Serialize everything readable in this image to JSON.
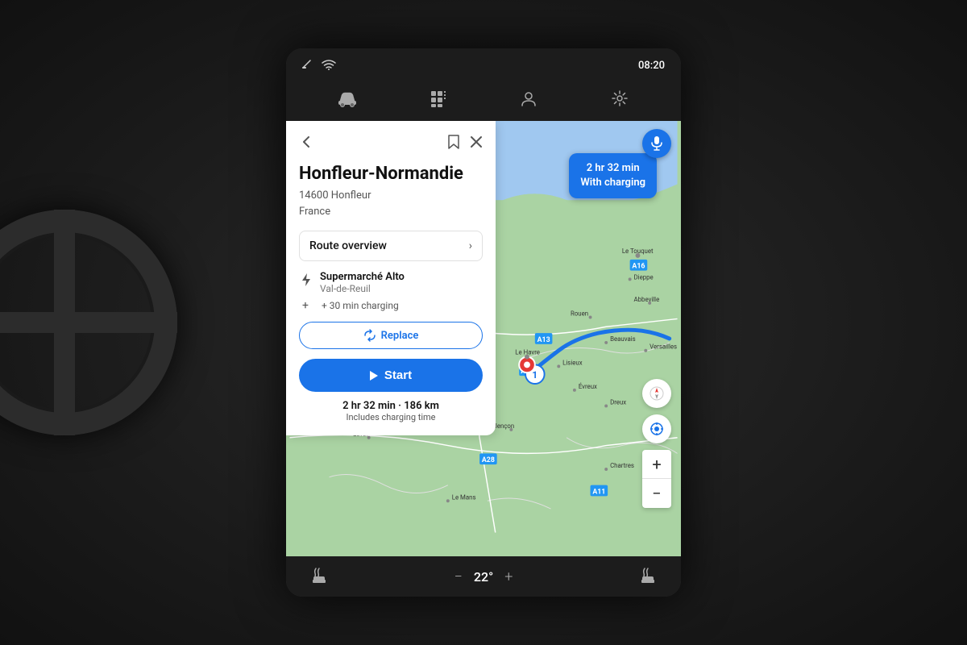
{
  "device": {
    "time": "08:20",
    "temperature": "22°"
  },
  "topbar": {
    "time": "08:20"
  },
  "navbar": {
    "car_icon": "🚗",
    "grid_icon": "⊞",
    "profile_icon": "👤",
    "settings_icon": "⚙"
  },
  "destination": {
    "name": "Honfleur-Normandie",
    "address_line1": "14600 Honfleur",
    "address_line2": "France"
  },
  "route": {
    "overview_label": "Route overview",
    "waypoint_name": "Supermarché Alto",
    "waypoint_sub": "Val-de-Reuil",
    "charging_text": "+ 30 min charging",
    "replace_label": "Replace",
    "start_label": "Start",
    "duration": "2 hr 32 min",
    "distance": "186 km",
    "includes_label": "Includes charging time",
    "badge_line1": "2 hr 32 min",
    "badge_line2": "With charging"
  },
  "map_controls": {
    "compass_label": "◎",
    "location_label": "◉",
    "zoom_in": "+",
    "zoom_out": "−"
  },
  "bottom_bar": {
    "seat_heat_left": "seat-heat-left",
    "temp_minus": "−",
    "temp_value": "22°",
    "temp_plus": "+",
    "seat_heat_right": "seat-heat-right"
  }
}
